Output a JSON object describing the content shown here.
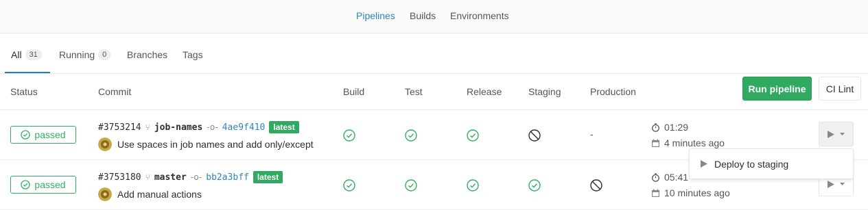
{
  "subnav": {
    "items": [
      {
        "label": "Pipelines",
        "active": true
      },
      {
        "label": "Builds",
        "active": false
      },
      {
        "label": "Environments",
        "active": false
      }
    ]
  },
  "tabs": {
    "all": {
      "label": "All",
      "count": "31"
    },
    "running": {
      "label": "Running",
      "count": "0"
    },
    "branches": {
      "label": "Branches"
    },
    "tags": {
      "label": "Tags"
    }
  },
  "actions": {
    "run_pipeline": "Run pipeline",
    "ci_lint": "CI Lint"
  },
  "columns": {
    "status": "Status",
    "commit": "Commit",
    "build": "Build",
    "test": "Test",
    "release": "Release",
    "staging": "Staging",
    "production": "Production"
  },
  "pipelines": [
    {
      "status": "passed",
      "id": "#3753214",
      "ref": "job-names",
      "sha": "4ae9f410",
      "latest_label": "latest",
      "message": "Use spaces in job names and add only/except",
      "stages": {
        "build": "success",
        "test": "success",
        "release": "success",
        "staging": "skipped",
        "production": "-"
      },
      "duration": "01:29",
      "finished": "4 minutes ago"
    },
    {
      "status": "passed",
      "id": "#3753180",
      "ref": "master",
      "sha": "bb2a3bff",
      "latest_label": "latest",
      "message": "Add manual actions",
      "stages": {
        "build": "success",
        "test": "success",
        "release": "success",
        "staging": "success",
        "production": "skipped"
      },
      "duration": "05:41",
      "finished": "10 minutes ago"
    }
  ],
  "dropdown": {
    "items": [
      "Deploy to staging"
    ]
  },
  "colors": {
    "success": "#31af64",
    "accent": "#3084bb",
    "skipped": "#2e2e2e"
  }
}
